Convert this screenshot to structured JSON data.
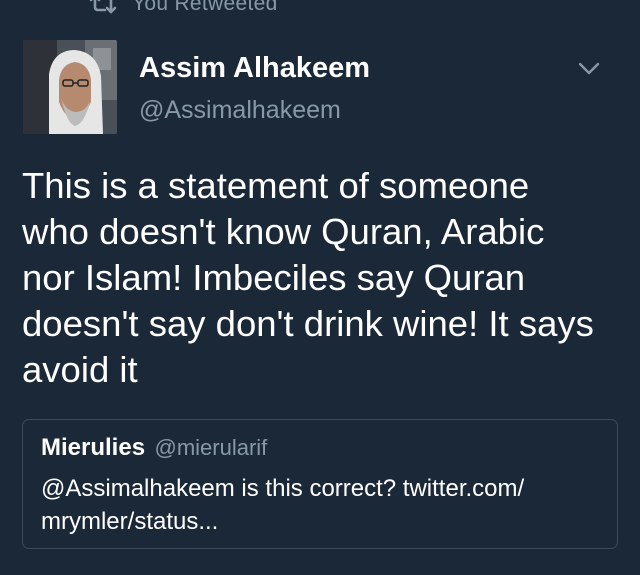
{
  "retweet_banner": {
    "icon": "retweet-icon",
    "label": "You Retweeted"
  },
  "tweet": {
    "avatar_icon": "avatar",
    "display_name": "Assim Alhakeem",
    "handle": "@Assimalhakeem",
    "menu_icon": "chevron-down-icon",
    "text_lines": [
      "This is a statement of someone",
      "who doesn't know Quran, Arabic",
      "nor Islam! Imbeciles say Quran",
      "doesn't say don't drink wine! It says",
      "avoid it"
    ]
  },
  "quoted_tweet": {
    "display_name": "Mierulies",
    "handle": "@mierularif",
    "text_lines": [
      "@Assimalhakeem is this correct? twitter.com/",
      "mrymler/status..."
    ]
  },
  "colors": {
    "background": "#1b2838",
    "primary_text": "#ffffff",
    "secondary_text": "#8899a6",
    "quote_border": "#3d4b5b"
  }
}
